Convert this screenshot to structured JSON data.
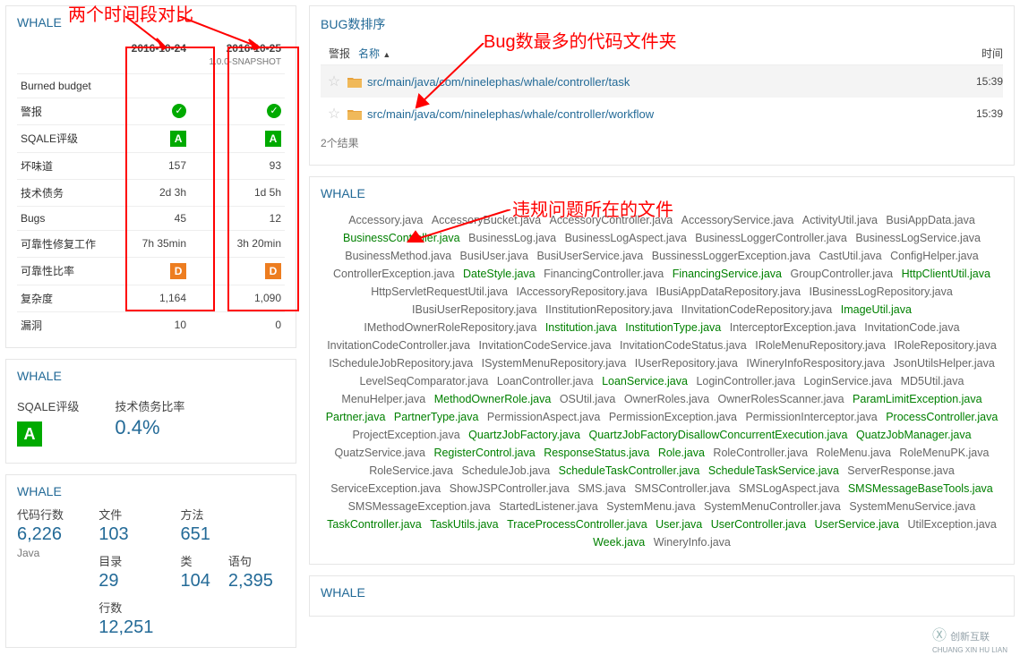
{
  "annotations": {
    "top_left": "两个时间段对比",
    "bug_folder": "Bug数最多的代码文件夹",
    "violation_file": "违规问题所在的文件"
  },
  "left": {
    "title_whale": "WHALE",
    "compare": {
      "col1_date": "2016-10-24",
      "col2_date": "2016-10-25",
      "col2_snapshot": "1.0.0-SNAPSHOT",
      "rows": [
        {
          "label": "Burned budget",
          "v1": "",
          "v2": ""
        },
        {
          "label": "警报",
          "v1": "check",
          "v2": "check"
        },
        {
          "label": "SQALE评级",
          "v1": "A",
          "v2": "A"
        },
        {
          "label": "坏味道",
          "v1": "157",
          "v2": "93"
        },
        {
          "label": "技术债务",
          "v1": "2d 3h",
          "v2": "1d 5h"
        },
        {
          "label": "Bugs",
          "v1": "45",
          "v2": "12"
        },
        {
          "label": "可靠性修复工作",
          "v1": "7h 35min",
          "v2": "3h 20min"
        },
        {
          "label": "可靠性比率",
          "v1": "D",
          "v2": "D"
        },
        {
          "label": "复杂度",
          "v1": "1,164",
          "v2": "1,090"
        },
        {
          "label": "漏洞",
          "v1": "10",
          "v2": "0"
        }
      ]
    },
    "sqale": {
      "rating_label": "SQALE评级",
      "rating": "A",
      "debt_label": "技术债务比率",
      "debt_ratio": "0.4%"
    },
    "metrics": {
      "lines_of_code_label": "代码行数",
      "lines_of_code": "6,226",
      "lang": "Java",
      "files_label": "文件",
      "files": "103",
      "dirs_label": "目录",
      "dirs": "29",
      "lines_label": "行数",
      "lines": "12,251",
      "methods_label": "方法",
      "methods": "651",
      "classes_label": "类",
      "classes": "104",
      "statements_label": "语句",
      "statements": "2,395"
    }
  },
  "right": {
    "bug_title": "BUG数排序",
    "header": {
      "alert": "警报",
      "name": "名称",
      "time": "时间"
    },
    "rows": [
      {
        "path": "src/main/java/com/ninelephas/whale/controller/task",
        "time": "15:39",
        "highlight": true
      },
      {
        "path": "src/main/java/com/ninelephas/whale/controller/workflow",
        "time": "15:39",
        "highlight": false
      }
    ],
    "result_count": "2个结果",
    "whale_title": "WHALE",
    "files": [
      {
        "n": "Accessory.java"
      },
      {
        "n": "AccessoryBucket.java"
      },
      {
        "n": "AccessoryController.java"
      },
      {
        "n": "AccessoryService.java"
      },
      {
        "n": "ActivityUtil.java"
      },
      {
        "n": "BusiAppData.java"
      },
      {
        "n": "BusinessController.java",
        "g": 1
      },
      {
        "n": "BusinessLog.java"
      },
      {
        "n": "BusinessLogAspect.java"
      },
      {
        "n": "BusinessLoggerController.java"
      },
      {
        "n": "BusinessLogService.java"
      },
      {
        "n": "BusinessMethod.java"
      },
      {
        "n": "BusiUser.java"
      },
      {
        "n": "BusiUserService.java"
      },
      {
        "n": "BussinessLoggerException.java"
      },
      {
        "n": "CastUtil.java"
      },
      {
        "n": "ConfigHelper.java"
      },
      {
        "n": "ControllerException.java"
      },
      {
        "n": "DateStyle.java",
        "g": 1
      },
      {
        "n": "FinancingController.java"
      },
      {
        "n": "FinancingService.java",
        "g": 1
      },
      {
        "n": "GroupController.java"
      },
      {
        "n": "HttpClientUtil.java",
        "g": 1
      },
      {
        "n": "HttpServletRequestUtil.java"
      },
      {
        "n": "IAccessoryRepository.java"
      },
      {
        "n": "IBusiAppDataRepository.java"
      },
      {
        "n": "IBusinessLogRepository.java"
      },
      {
        "n": "IBusiUserRepository.java"
      },
      {
        "n": "IInstitutionRepository.java"
      },
      {
        "n": "IInvitationCodeRepository.java"
      },
      {
        "n": "ImageUtil.java",
        "g": 1
      },
      {
        "n": "IMethodOwnerRoleRepository.java"
      },
      {
        "n": "Institution.java",
        "g": 1
      },
      {
        "n": "InstitutionType.java",
        "g": 1
      },
      {
        "n": "InterceptorException.java"
      },
      {
        "n": "InvitationCode.java"
      },
      {
        "n": "InvitationCodeController.java"
      },
      {
        "n": "InvitationCodeService.java"
      },
      {
        "n": "InvitationCodeStatus.java"
      },
      {
        "n": "IRoleMenuRepository.java"
      },
      {
        "n": "IRoleRepository.java"
      },
      {
        "n": "IScheduleJobRepository.java"
      },
      {
        "n": "ISystemMenuRepository.java"
      },
      {
        "n": "IUserRepository.java"
      },
      {
        "n": "IWineryInfoRespository.java"
      },
      {
        "n": "JsonUtilsHelper.java"
      },
      {
        "n": "LevelSeqComparator.java"
      },
      {
        "n": "LoanController.java"
      },
      {
        "n": "LoanService.java",
        "g": 1
      },
      {
        "n": "LoginController.java"
      },
      {
        "n": "LoginService.java"
      },
      {
        "n": "MD5Util.java"
      },
      {
        "n": "MenuHelper.java"
      },
      {
        "n": "MethodOwnerRole.java",
        "g": 1
      },
      {
        "n": "OSUtil.java"
      },
      {
        "n": "OwnerRoles.java"
      },
      {
        "n": "OwnerRolesScanner.java"
      },
      {
        "n": "ParamLimitException.java",
        "g": 1
      },
      {
        "n": "Partner.java",
        "g": 1
      },
      {
        "n": "PartnerType.java",
        "g": 1
      },
      {
        "n": "PermissionAspect.java"
      },
      {
        "n": "PermissionException.java"
      },
      {
        "n": "PermissionInterceptor.java"
      },
      {
        "n": "ProcessController.java",
        "g": 1
      },
      {
        "n": "ProjectException.java"
      },
      {
        "n": "QuartzJobFactory.java",
        "g": 1
      },
      {
        "n": "QuartzJobFactoryDisallowConcurrentExecution.java",
        "g": 1
      },
      {
        "n": "QuatzJobManager.java",
        "g": 1
      },
      {
        "n": "QuatzService.java"
      },
      {
        "n": "RegisterControl.java",
        "g": 1
      },
      {
        "n": "ResponseStatus.java",
        "g": 1
      },
      {
        "n": "Role.java",
        "g": 1
      },
      {
        "n": "RoleController.java"
      },
      {
        "n": "RoleMenu.java"
      },
      {
        "n": "RoleMenuPK.java"
      },
      {
        "n": "RoleService.java"
      },
      {
        "n": "ScheduleJob.java"
      },
      {
        "n": "ScheduleTaskController.java",
        "g": 1
      },
      {
        "n": "ScheduleTaskService.java",
        "g": 1
      },
      {
        "n": "ServerResponse.java"
      },
      {
        "n": "ServiceException.java"
      },
      {
        "n": "ShowJSPController.java"
      },
      {
        "n": "SMS.java"
      },
      {
        "n": "SMSController.java"
      },
      {
        "n": "SMSLogAspect.java"
      },
      {
        "n": "SMSMessageBaseTools.java",
        "g": 1
      },
      {
        "n": "SMSMessageException.java"
      },
      {
        "n": "StartedListener.java"
      },
      {
        "n": "SystemMenu.java"
      },
      {
        "n": "SystemMenuController.java"
      },
      {
        "n": "SystemMenuService.java"
      },
      {
        "n": "TaskController.java",
        "g": 1
      },
      {
        "n": "TaskUtils.java",
        "g": 1
      },
      {
        "n": "TraceProcessController.java",
        "g": 1
      },
      {
        "n": "User.java",
        "g": 1
      },
      {
        "n": "UserController.java",
        "g": 1
      },
      {
        "n": "UserService.java",
        "g": 1
      },
      {
        "n": "UtilException.java"
      },
      {
        "n": "Week.java",
        "g": 1
      },
      {
        "n": "WineryInfo.java"
      }
    ],
    "bottom_whale": "WHALE"
  },
  "watermark": {
    "big": "创新互联",
    "small": "CHUANG XIN HU LIAN"
  }
}
